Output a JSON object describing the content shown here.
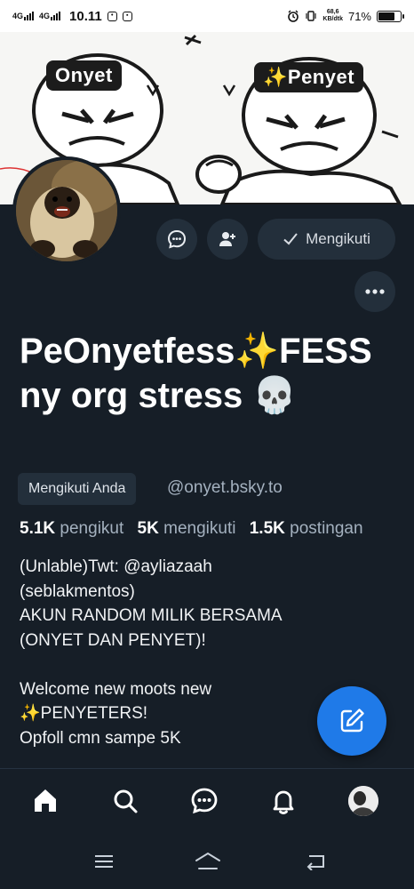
{
  "status_bar": {
    "signal_1": "4G",
    "signal_2": "4G",
    "time": "10.11",
    "speed_value": "68,6",
    "speed_unit": "KB/dtk",
    "battery": "71%",
    "battery_level": 0.71
  },
  "banner": {
    "tag_left": "Onyet",
    "tag_right": "✨Penyet"
  },
  "actions": {
    "following_label": "Mengikuti"
  },
  "profile": {
    "display_name": "PeOnyetfess✨FESSny org stress 💀",
    "follows_you": "Mengikuti Anda",
    "handle": "@onyet.bsky.to",
    "followers_count": "5.1K",
    "followers_label": "pengikut",
    "following_count": "5K",
    "following_label": "mengikuti",
    "posts_count": "1.5K",
    "posts_label": "postingan",
    "bio": "(Unlable)Twt: @ayliazaah\n(seblakmentos)\nAKUN RANDOM MILIK BERSAMA\n(ONYET DAN PENYET)!\n\nWelcome new moots new\n✨PENYETERS!\nOpfoll cmn sampe 5K"
  },
  "colors": {
    "background": "#161e27",
    "button_bg": "#232f3b",
    "accent": "#1f7ae8",
    "muted_text": "#a4b1bf"
  },
  "icons": {
    "nav": [
      "home-icon",
      "search-icon",
      "chat-icon",
      "bell-icon",
      "profile-avatar"
    ],
    "fab": "compose-icon"
  }
}
